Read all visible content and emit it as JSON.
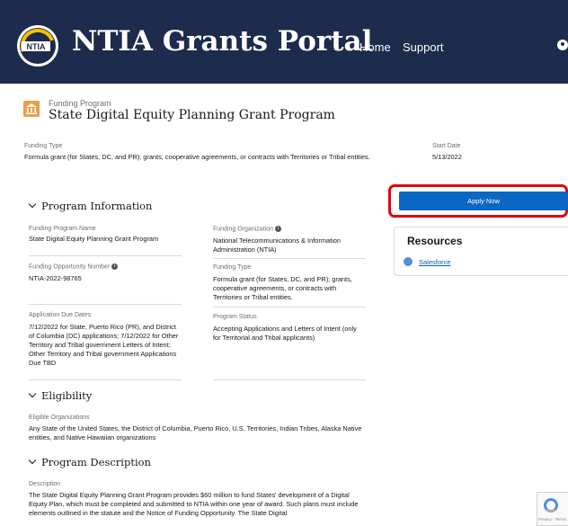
{
  "header": {
    "title": "NTIA Grants Portal",
    "logo_text": "NTIA",
    "nav": {
      "home": "Home",
      "support": "Support"
    }
  },
  "record": {
    "type_label": "Funding Program",
    "title": "State Digital Equity Planning Grant Program"
  },
  "summary": {
    "funding_type_label": "Funding Type",
    "funding_type_value": "Formula grant (for States, DC, and PR); grants, cooperative agreements, or contracts with Territories or Tribal entities.",
    "start_date_label": "Start Date",
    "start_date_value": "5/13/2022"
  },
  "program_info": {
    "heading": "Program Information",
    "fields": {
      "program_name_label": "Funding Program Name",
      "program_name_value": "State Digital Equity Planning Grant Program",
      "organization_label": "Funding Organization",
      "organization_value": "National Telecommunications & Information Administration (NTIA)",
      "opportunity_label": "Funding Opportunity Number",
      "opportunity_value": "NTIA-2022-98765",
      "funding_type_label": "Funding Type",
      "funding_type_value": "Formula grant (for States, DC, and PR); grants, cooperative agreements, or contracts with Territories or Tribal entities.",
      "due_dates_label": "Application Due Dates",
      "due_dates_value": "7/12/2022 for State, Puerto Rico (PR), and District of Columbia (DC) applications; 7/12/2022 for Other Territory and Tribal government Letters of Intent; Other Territory and Tribal government Applications Due TBD",
      "status_label": "Program Status",
      "status_value": "Accepting Applications and Letters of Intent (only for Territorial and Tribal applicants)"
    }
  },
  "eligibility": {
    "heading": "Eligibility",
    "label": "Eligible Organizations",
    "value": "Any State of the United States, the District of Columbia, Puerto Rico, U.S. Territories, Indian Tribes, Alaska Native entities, and Native Hawaiian organizations"
  },
  "description": {
    "heading": "Program Description",
    "label": "Description",
    "value": "The State Digital Equity Planning Grant Program provides $60 million to fund States' development of a Digital Equity Plan, which must be completed and submitted to NTIA within one year of award. Such plans must include elements outlined in the statute and the Notice of Funding Opportunity. The State Digital"
  },
  "sidebar": {
    "apply_label": "Apply Now",
    "resources_title": "Resources",
    "resource_link": "Salesforce"
  },
  "recaptcha": {
    "text": "Privacy - Terms"
  },
  "colors": {
    "header_bg": "#1d2b4c",
    "apply_button": "#0b67c4",
    "highlight": "#e4000f",
    "record_icon": "#e8a04a"
  },
  "icons": [
    "ntia-logo",
    "bank-icon",
    "info-icon",
    "chevron-down-icon",
    "salesforce-icon",
    "user-icon",
    "recaptcha-icon"
  ]
}
